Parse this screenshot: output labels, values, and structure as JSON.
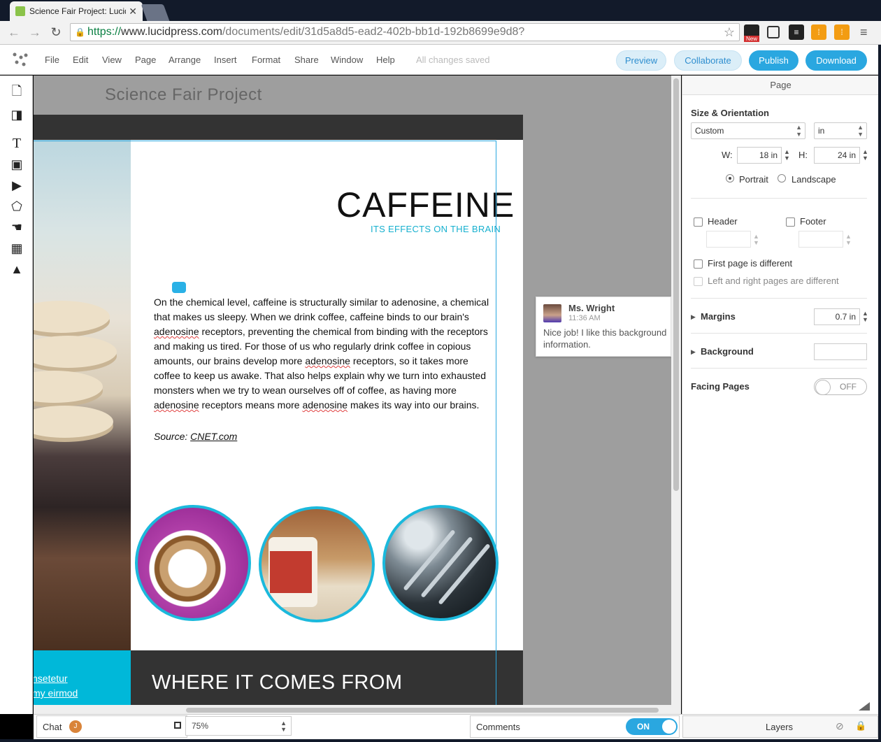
{
  "browser": {
    "tab_title": "Science Fair Project: Lucid",
    "url_scheme": "https://",
    "url_host": "www.lucidpress.com",
    "url_path": "/documents/edit/31d5a8d5-ead2-402b-bb1d-192b8699e9d8?",
    "ext_badge": "New"
  },
  "menubar": {
    "items": [
      "File",
      "Edit",
      "View",
      "Page",
      "Arrange",
      "Insert",
      "Format",
      "Share",
      "Window",
      "Help"
    ],
    "status": "All changes saved",
    "preview": "Preview",
    "collaborate": "Collaborate",
    "publish": "Publish",
    "download": "Download"
  },
  "document": {
    "title": "Science Fair Project",
    "heading": "CAFFEINE",
    "subheading": "ITS EFFECTS ON THE BRAIN",
    "body": [
      "On the chemical level, caffeine is structurally similar to adenosine, a chemical that makes us sleepy. When we drink coffee, caffeine binds to our brain's ",
      "adenosine",
      " receptors, preventing the chemical from binding with the receptors and making us tired. For those of us who regularly drink coffee in copious amounts, our brains develop more ",
      "adenosine",
      " receptors, so it takes more coffee to keep us awake. That also helps explain why we turn into exhausted monsters when we try to wean ourselves off of coffee, as having more ",
      "adenosine",
      " receptors means more ",
      "adenosine",
      " makes its way into our brains."
    ],
    "source_label": "Source: ",
    "source_link": "CNET.com",
    "section_heading": "WHERE IT COMES FROM",
    "sidebar_lines": [
      "nsetetur",
      "my eirmod",
      "ians manu"
    ]
  },
  "comment": {
    "author": "Ms. Wright",
    "time": "11:36 AM",
    "text": "Nice job! I like this background information."
  },
  "panel": {
    "title": "Page",
    "size_heading": "Size & Orientation",
    "size_preset": "Custom",
    "unit": "in",
    "w_label": "W:",
    "w_value": "18 in",
    "h_label": "H:",
    "h_value": "24 in",
    "portrait": "Portrait",
    "landscape": "Landscape",
    "header": "Header",
    "footer": "Footer",
    "first_page_different": "First page is different",
    "left_right_different": "Left and right pages are different",
    "margins": "Margins",
    "margins_value": "0.7 in",
    "background": "Background",
    "facing_pages": "Facing Pages",
    "facing_state": "OFF"
  },
  "bottombar": {
    "chat": "Chat",
    "chat_badge": "J",
    "zoom": "75%",
    "comments": "Comments",
    "comments_state": "ON",
    "layers": "Layers"
  },
  "colors": {
    "accent": "#2aa7e0",
    "cyan": "#00b8d9",
    "dark_band": "#333333"
  }
}
